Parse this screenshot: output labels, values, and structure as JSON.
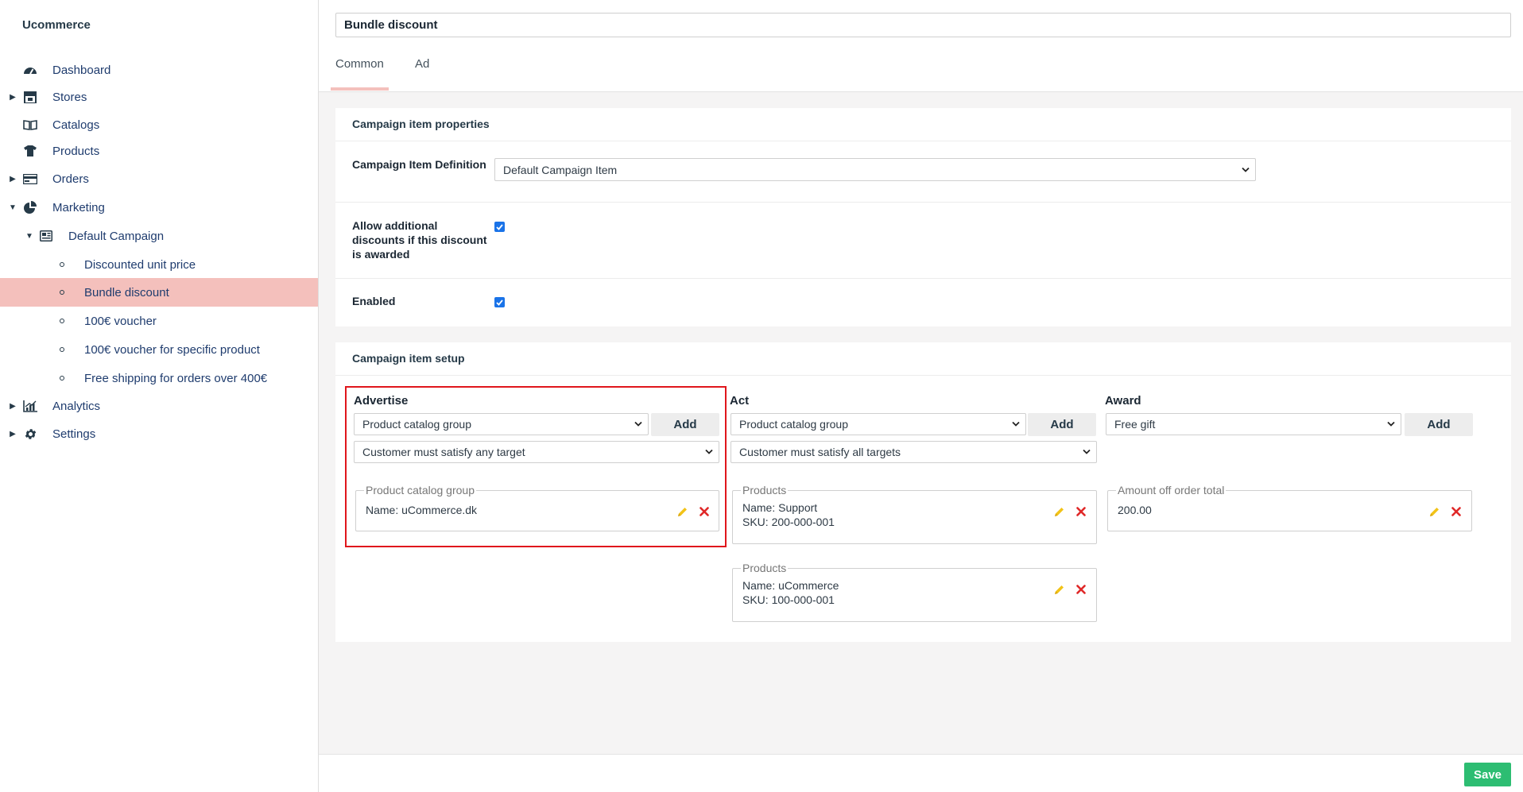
{
  "sidebar": {
    "brand": "Ucommerce",
    "items": [
      {
        "label": "Dashboard"
      },
      {
        "label": "Stores"
      },
      {
        "label": "Catalogs"
      },
      {
        "label": "Products"
      },
      {
        "label": "Orders"
      },
      {
        "label": "Marketing"
      },
      {
        "label": "Default Campaign"
      },
      {
        "label": "Discounted unit price"
      },
      {
        "label": "Bundle discount"
      },
      {
        "label": "100€ voucher"
      },
      {
        "label": "100€ voucher for specific product"
      },
      {
        "label": "Free shipping for orders over 400€"
      },
      {
        "label": "Analytics"
      },
      {
        "label": "Settings"
      }
    ],
    "selected": "Bundle discount"
  },
  "header": {
    "title_value": "Bundle discount",
    "tabs": [
      {
        "label": "Common"
      },
      {
        "label": "Ad"
      }
    ]
  },
  "properties": {
    "title": "Campaign item properties",
    "definition_label": "Campaign Item Definition",
    "definition_value": "Default Campaign Item",
    "allow_label": "Allow additional discounts if this discount is awarded",
    "enabled_label": "Enabled"
  },
  "setup": {
    "title": "Campaign item setup",
    "add_label": "Add",
    "advertise": {
      "title": "Advertise",
      "type_value": "Product catalog group",
      "target_value": "Customer must satisfy any target",
      "targets": [
        {
          "legend": "Product catalog group",
          "line1": "Name: uCommerce.dk"
        }
      ]
    },
    "act": {
      "title": "Act",
      "type_value": "Product catalog group",
      "target_value": "Customer must satisfy all targets",
      "targets": [
        {
          "legend": "Products",
          "line1": "Name: Support",
          "line2": "SKU: 200-000-001"
        },
        {
          "legend": "Products",
          "line1": "Name: uCommerce",
          "line2": "SKU: 100-000-001"
        }
      ]
    },
    "award": {
      "title": "Award",
      "type_value": "Free gift",
      "awards": [
        {
          "legend": "Amount off order total",
          "line1": "200.00"
        }
      ]
    }
  },
  "footer": {
    "save_label": "Save"
  },
  "colors": {
    "selected_bg": "#f4c0bc",
    "save_green": "#2dbd72",
    "highlight_red": "#e0161c",
    "checkbox_blue": "#1a73e8"
  }
}
